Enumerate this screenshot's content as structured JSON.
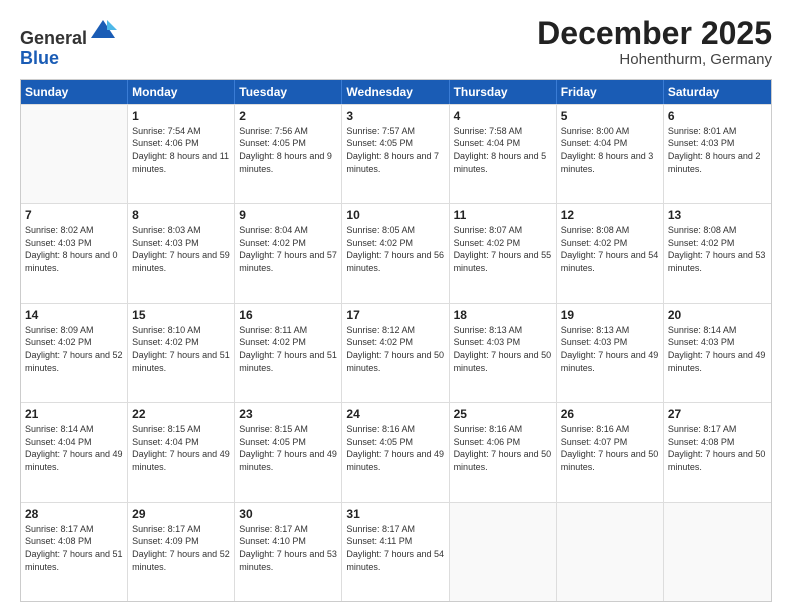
{
  "header": {
    "logo": {
      "line1": "General",
      "line2": "Blue"
    },
    "title": "December 2025",
    "location": "Hohenthurm, Germany"
  },
  "days_of_week": [
    "Sunday",
    "Monday",
    "Tuesday",
    "Wednesday",
    "Thursday",
    "Friday",
    "Saturday"
  ],
  "weeks": [
    [
      {
        "day": "",
        "empty": true
      },
      {
        "day": "1",
        "sunrise": "7:54 AM",
        "sunset": "4:06 PM",
        "daylight": "8 hours and 11 minutes."
      },
      {
        "day": "2",
        "sunrise": "7:56 AM",
        "sunset": "4:05 PM",
        "daylight": "8 hours and 9 minutes."
      },
      {
        "day": "3",
        "sunrise": "7:57 AM",
        "sunset": "4:05 PM",
        "daylight": "8 hours and 7 minutes."
      },
      {
        "day": "4",
        "sunrise": "7:58 AM",
        "sunset": "4:04 PM",
        "daylight": "8 hours and 5 minutes."
      },
      {
        "day": "5",
        "sunrise": "8:00 AM",
        "sunset": "4:04 PM",
        "daylight": "8 hours and 3 minutes."
      },
      {
        "day": "6",
        "sunrise": "8:01 AM",
        "sunset": "4:03 PM",
        "daylight": "8 hours and 2 minutes."
      }
    ],
    [
      {
        "day": "7",
        "sunrise": "8:02 AM",
        "sunset": "4:03 PM",
        "daylight": "8 hours and 0 minutes."
      },
      {
        "day": "8",
        "sunrise": "8:03 AM",
        "sunset": "4:03 PM",
        "daylight": "7 hours and 59 minutes."
      },
      {
        "day": "9",
        "sunrise": "8:04 AM",
        "sunset": "4:02 PM",
        "daylight": "7 hours and 57 minutes."
      },
      {
        "day": "10",
        "sunrise": "8:05 AM",
        "sunset": "4:02 PM",
        "daylight": "7 hours and 56 minutes."
      },
      {
        "day": "11",
        "sunrise": "8:07 AM",
        "sunset": "4:02 PM",
        "daylight": "7 hours and 55 minutes."
      },
      {
        "day": "12",
        "sunrise": "8:08 AM",
        "sunset": "4:02 PM",
        "daylight": "7 hours and 54 minutes."
      },
      {
        "day": "13",
        "sunrise": "8:08 AM",
        "sunset": "4:02 PM",
        "daylight": "7 hours and 53 minutes."
      }
    ],
    [
      {
        "day": "14",
        "sunrise": "8:09 AM",
        "sunset": "4:02 PM",
        "daylight": "7 hours and 52 minutes."
      },
      {
        "day": "15",
        "sunrise": "8:10 AM",
        "sunset": "4:02 PM",
        "daylight": "7 hours and 51 minutes."
      },
      {
        "day": "16",
        "sunrise": "8:11 AM",
        "sunset": "4:02 PM",
        "daylight": "7 hours and 51 minutes."
      },
      {
        "day": "17",
        "sunrise": "8:12 AM",
        "sunset": "4:02 PM",
        "daylight": "7 hours and 50 minutes."
      },
      {
        "day": "18",
        "sunrise": "8:13 AM",
        "sunset": "4:03 PM",
        "daylight": "7 hours and 50 minutes."
      },
      {
        "day": "19",
        "sunrise": "8:13 AM",
        "sunset": "4:03 PM",
        "daylight": "7 hours and 49 minutes."
      },
      {
        "day": "20",
        "sunrise": "8:14 AM",
        "sunset": "4:03 PM",
        "daylight": "7 hours and 49 minutes."
      }
    ],
    [
      {
        "day": "21",
        "sunrise": "8:14 AM",
        "sunset": "4:04 PM",
        "daylight": "7 hours and 49 minutes."
      },
      {
        "day": "22",
        "sunrise": "8:15 AM",
        "sunset": "4:04 PM",
        "daylight": "7 hours and 49 minutes."
      },
      {
        "day": "23",
        "sunrise": "8:15 AM",
        "sunset": "4:05 PM",
        "daylight": "7 hours and 49 minutes."
      },
      {
        "day": "24",
        "sunrise": "8:16 AM",
        "sunset": "4:05 PM",
        "daylight": "7 hours and 49 minutes."
      },
      {
        "day": "25",
        "sunrise": "8:16 AM",
        "sunset": "4:06 PM",
        "daylight": "7 hours and 50 minutes."
      },
      {
        "day": "26",
        "sunrise": "8:16 AM",
        "sunset": "4:07 PM",
        "daylight": "7 hours and 50 minutes."
      },
      {
        "day": "27",
        "sunrise": "8:17 AM",
        "sunset": "4:08 PM",
        "daylight": "7 hours and 50 minutes."
      }
    ],
    [
      {
        "day": "28",
        "sunrise": "8:17 AM",
        "sunset": "4:08 PM",
        "daylight": "7 hours and 51 minutes."
      },
      {
        "day": "29",
        "sunrise": "8:17 AM",
        "sunset": "4:09 PM",
        "daylight": "7 hours and 52 minutes."
      },
      {
        "day": "30",
        "sunrise": "8:17 AM",
        "sunset": "4:10 PM",
        "daylight": "7 hours and 53 minutes."
      },
      {
        "day": "31",
        "sunrise": "8:17 AM",
        "sunset": "4:11 PM",
        "daylight": "7 hours and 54 minutes."
      },
      {
        "day": "",
        "empty": true
      },
      {
        "day": "",
        "empty": true
      },
      {
        "day": "",
        "empty": true
      }
    ]
  ]
}
